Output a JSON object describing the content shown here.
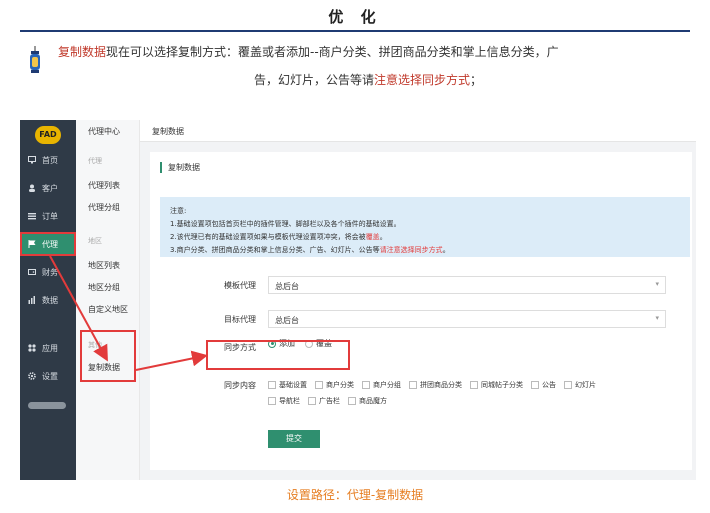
{
  "article": {
    "title": "优 化",
    "desc_red1": "复制数据",
    "desc_text1": "现在可以选择复制方式：覆盖或者添加--商户分类、拼团商品分类和掌上信息分类，广",
    "desc_text2": "告，幻灯片，公告等请",
    "desc_red2": "注意选择同步方式",
    "desc_text3": "；",
    "caption": "设置路径：代理-复制数据"
  },
  "app": {
    "logo": "FAD",
    "nav": [
      "首页",
      "客户",
      "订单",
      "代理",
      "财务",
      "数据",
      "应用",
      "设置"
    ],
    "nav_icons": [
      "monitor-icon",
      "user-icon",
      "list-icon",
      "flag-icon",
      "wallet-icon",
      "chart-icon",
      "apps-icon",
      "gear-icon"
    ],
    "submenu": {
      "header": "代理中心",
      "group1": "代理",
      "items1": [
        "代理列表",
        "代理分组"
      ],
      "group2": "地区",
      "items2": [
        "地区列表",
        "地区分组",
        "自定义地区"
      ],
      "group3": "其他",
      "items3": [
        "复制数据"
      ]
    },
    "breadcrumb": "复制数据",
    "card_title": "复制数据",
    "notice": {
      "title": "注意:",
      "line1": "1.基础设置项包括首页栏中的插件管理、脚部栏以及各个插件的基础设置。",
      "line2a": "2.该代理已有的基础设置项如果与模板代理设置项冲突，将会被",
      "line2red": "覆盖",
      "line2b": "。",
      "line3a": "3.商户分类、拼团商品分类和掌上信息分类、广告、幻灯片、公告等",
      "line3red": "请注意选择同步方式",
      "line3b": "。"
    },
    "form": {
      "template_label": "模板代理",
      "template_value": "总后台",
      "target_label": "目标代理",
      "target_value": "总后台",
      "sync_label": "同步方式",
      "sync_options": [
        "添加",
        "覆盖"
      ],
      "sync_selected": "添加",
      "content_label": "同步内容",
      "content_options": [
        "基础设置",
        "商户分类",
        "商户分组",
        "拼团商品分类",
        "同城帖子分类",
        "公告",
        "幻灯片",
        "导航栏",
        "广告栏",
        "商品魔方"
      ],
      "submit": "提交"
    }
  },
  "colors": {
    "accent": "#2f8f6f",
    "highlight": "#e23b3b",
    "caption": "#e67e22",
    "sidebar": "#2f3a47"
  }
}
